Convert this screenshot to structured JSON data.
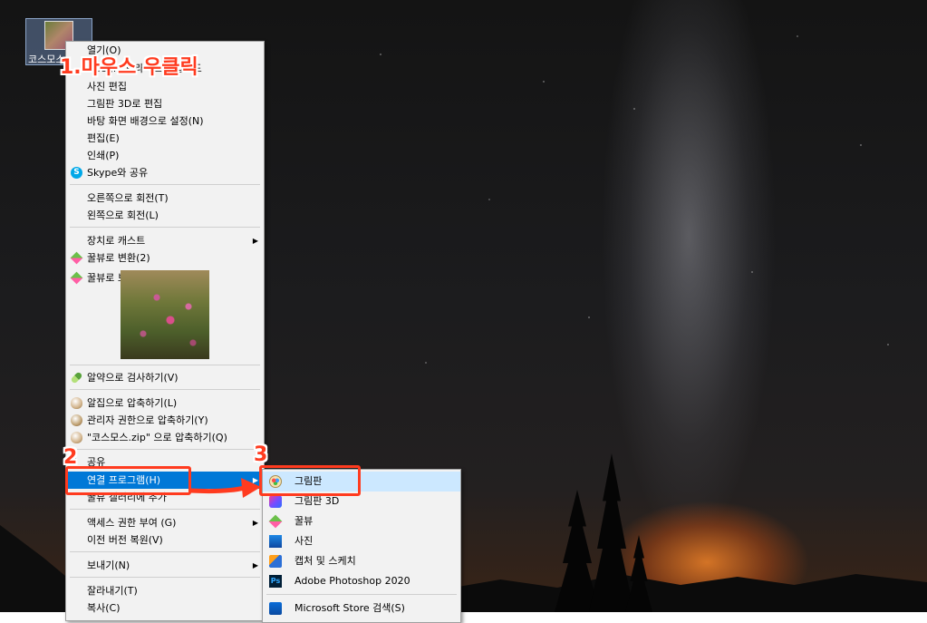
{
  "desktop_icon": {
    "label": "코스모스"
  },
  "context_menu": {
    "items": [
      {
        "label": "열기(O)"
      },
      {
        "label": "Google 드라이브에 업로드"
      },
      {
        "label": "사진 편집"
      },
      {
        "label": "그림판 3D로 편집"
      },
      {
        "label": "바탕 화면 배경으로 설정(N)"
      },
      {
        "label": "편집(E)"
      },
      {
        "label": "인쇄(P)"
      },
      {
        "label": "Skype와 공유",
        "icon": "skype-icon"
      },
      {
        "label": "오른쪽으로 회전(T)"
      },
      {
        "label": "왼쪽으로 회전(L)"
      },
      {
        "label": "장치로 캐스트",
        "submenu": true
      },
      {
        "label": "꿀뷰로 변환(2)",
        "icon": "honeyview-icon"
      },
      {
        "label": "꿀뷰로 보기(3)",
        "icon": "honeyview-icon"
      },
      {
        "label": "알약으로 검사하기(V)",
        "icon": "alyac-icon"
      },
      {
        "label": "알집으로 압축하기(L)",
        "icon": "alzip-icon"
      },
      {
        "label": "관리자 권한으로 압축하기(Y)",
        "icon": "alzip-admin-icon"
      },
      {
        "label": "\"코스모스.zip\" 으로 압축하기(Q)",
        "icon": "alzip-icon"
      },
      {
        "label": "공유",
        "icon": "share-icon"
      },
      {
        "label": "연결 프로그램(H)",
        "submenu": true,
        "highlighted": true
      },
      {
        "label": "꿀뷰 갤러리에 추가"
      },
      {
        "label": "액세스 권한 부여 (G)",
        "submenu": true
      },
      {
        "label": "이전 버전 복원(V)"
      },
      {
        "label": "보내기(N)",
        "submenu": true
      },
      {
        "label": "잘라내기(T)"
      },
      {
        "label": "복사(C)"
      }
    ]
  },
  "open_with_submenu": {
    "items": [
      {
        "label": "그림판",
        "icon": "paint-icon",
        "highlighted": true
      },
      {
        "label": "그림판 3D",
        "icon": "paint3d-icon"
      },
      {
        "label": "꿀뷰",
        "icon": "honeyview-icon"
      },
      {
        "label": "사진",
        "icon": "photos-icon"
      },
      {
        "label": "캡처 및 스케치",
        "icon": "snip-sketch-icon"
      },
      {
        "label": "Adobe Photoshop 2020",
        "icon": "photoshop-icon",
        "icon_text": "Ps"
      },
      {
        "label": "Microsoft Store 검색(S)",
        "icon": "store-icon"
      }
    ]
  },
  "annotations": {
    "step1": "1.마우스 우클릭",
    "step2": "2",
    "step3": "3"
  },
  "colors": {
    "highlight": "#0078d7",
    "submenu_highlight": "#cce8ff",
    "annotation": "#ff3b1f"
  }
}
